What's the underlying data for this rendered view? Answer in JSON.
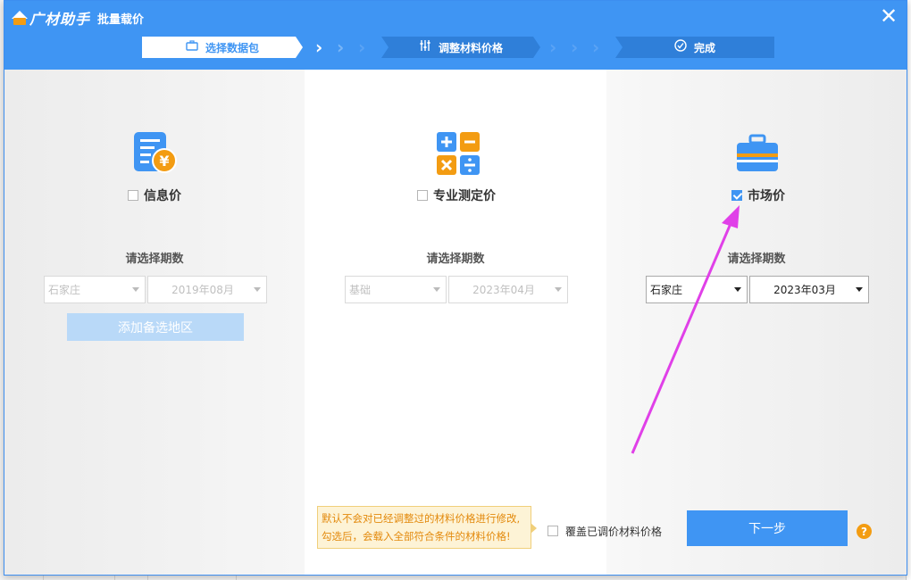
{
  "app": {
    "logo_text": "广材助手",
    "dialog_title": "批量载价",
    "close_glyph": "✕"
  },
  "steps": [
    {
      "label": "选择数据包",
      "icon": "briefcase-icon",
      "active": true
    },
    {
      "label": "调整材料价格",
      "icon": "sliders-icon",
      "active": false
    },
    {
      "label": "完成",
      "icon": "check-circle-icon",
      "active": false
    }
  ],
  "options": [
    {
      "label": "信息价",
      "icon": "price-document-icon",
      "checked": false,
      "period_label": "请选择期数",
      "region_select": "石家庄",
      "date_select": "2019年08月",
      "add_region_label": "添加备选地区"
    },
    {
      "label": "专业测定价",
      "icon": "calculator-icon",
      "checked": false,
      "period_label": "请选择期数",
      "region_select": "基础",
      "date_select": "2023年04月"
    },
    {
      "label": "市场价",
      "icon": "toolbox-icon",
      "checked": true,
      "period_label": "请选择期数",
      "region_select": "石家庄",
      "date_select": "2023年03月"
    }
  ],
  "footer": {
    "tooltip_line1": "默认不会对已经调整过的材料价格进行修改,",
    "tooltip_line2": "勾选后，会载入全部符合条件的材料价格!",
    "overwrite_label": "覆盖已调价材料价格",
    "overwrite_checked": false,
    "next_label": "下一步",
    "help_glyph": "?"
  },
  "colors": {
    "primary": "#3f95f3",
    "step_dark": "#2f7fd9",
    "orange": "#f39c12",
    "annotation_arrow": "#e040e8"
  }
}
